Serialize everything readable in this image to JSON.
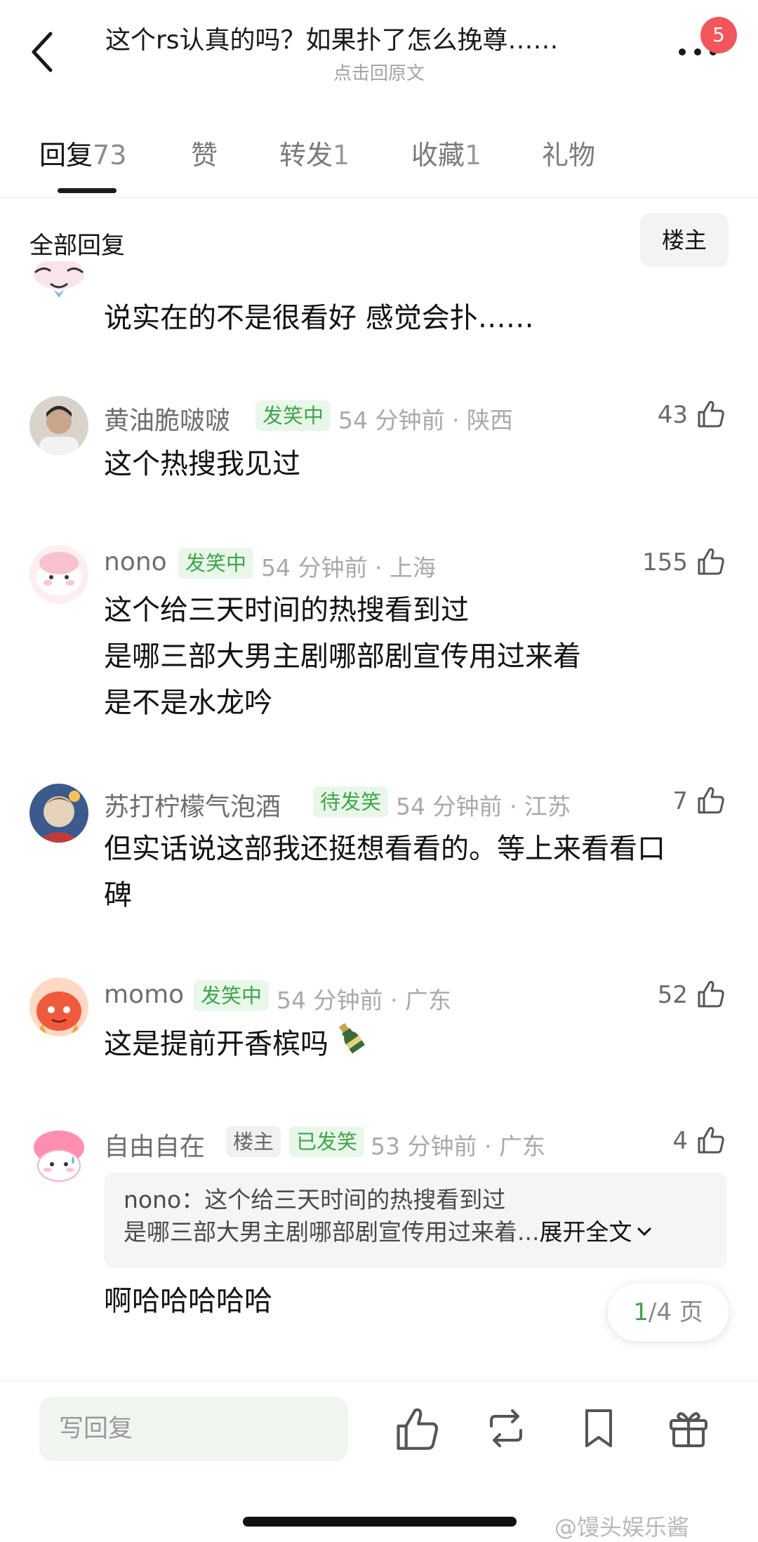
{
  "header": {
    "title": "这个rs认真的吗？如果扑了怎么挽尊……",
    "subtitle": "点击回原文",
    "badge_count": "5"
  },
  "tabs": [
    {
      "label": "回复",
      "count": "73",
      "active": true
    },
    {
      "label": "赞",
      "count": "",
      "active": false
    },
    {
      "label": "转发",
      "count": "1",
      "active": false
    },
    {
      "label": "收藏",
      "count": "1",
      "active": false
    },
    {
      "label": "礼物",
      "count": "",
      "active": false
    }
  ],
  "filter": {
    "label": "全部回复",
    "owner_button": "楼主"
  },
  "comments": [
    {
      "text": "说实在的不是很看好 感觉会扑……"
    },
    {
      "name": "黄油脆啵啵",
      "tag": "发笑中",
      "time": "54 分钟前 · 陕西",
      "likes": "43",
      "lines": [
        "这个热搜我见过"
      ]
    },
    {
      "name": "nono",
      "tag": "发笑中",
      "time": "54 分钟前 · 上海",
      "likes": "155",
      "lines": [
        "这个给三天时间的热搜看到过",
        "是哪三部大男主剧哪部剧宣传用过来着",
        "是不是水龙吟"
      ]
    },
    {
      "name": "苏打柠檬气泡酒",
      "tag": "待发笑",
      "time": "54 分钟前 · 江苏",
      "likes": "7",
      "lines": [
        "但实话说这部我还挺想看看的。等上来看看口",
        "碑"
      ]
    },
    {
      "name": "momo",
      "tag": "发笑中",
      "time": "54 分钟前 · 广东",
      "likes": "52",
      "lines": [
        "这是提前开香槟吗"
      ]
    },
    {
      "name": "自由自在",
      "owner_tag": "楼主",
      "tag": "已发笑",
      "time": "53 分钟前 · 广东",
      "likes": "4",
      "quote": {
        "author": "nono：",
        "line1": "这个给三天时间的热搜看到过",
        "line2": "是哪三部大男主剧哪部剧宣传用过来着...",
        "expand": "展开全文"
      },
      "lines": [
        "啊哈哈哈哈哈"
      ]
    }
  ],
  "pager": {
    "current": "1",
    "total": "/4 页"
  },
  "bottom": {
    "reply_placeholder": "写回复"
  },
  "watermark": "@馒头娱乐酱",
  "colors": {
    "accent_green": "#3fa54a",
    "badge_red": "#f2555a"
  }
}
